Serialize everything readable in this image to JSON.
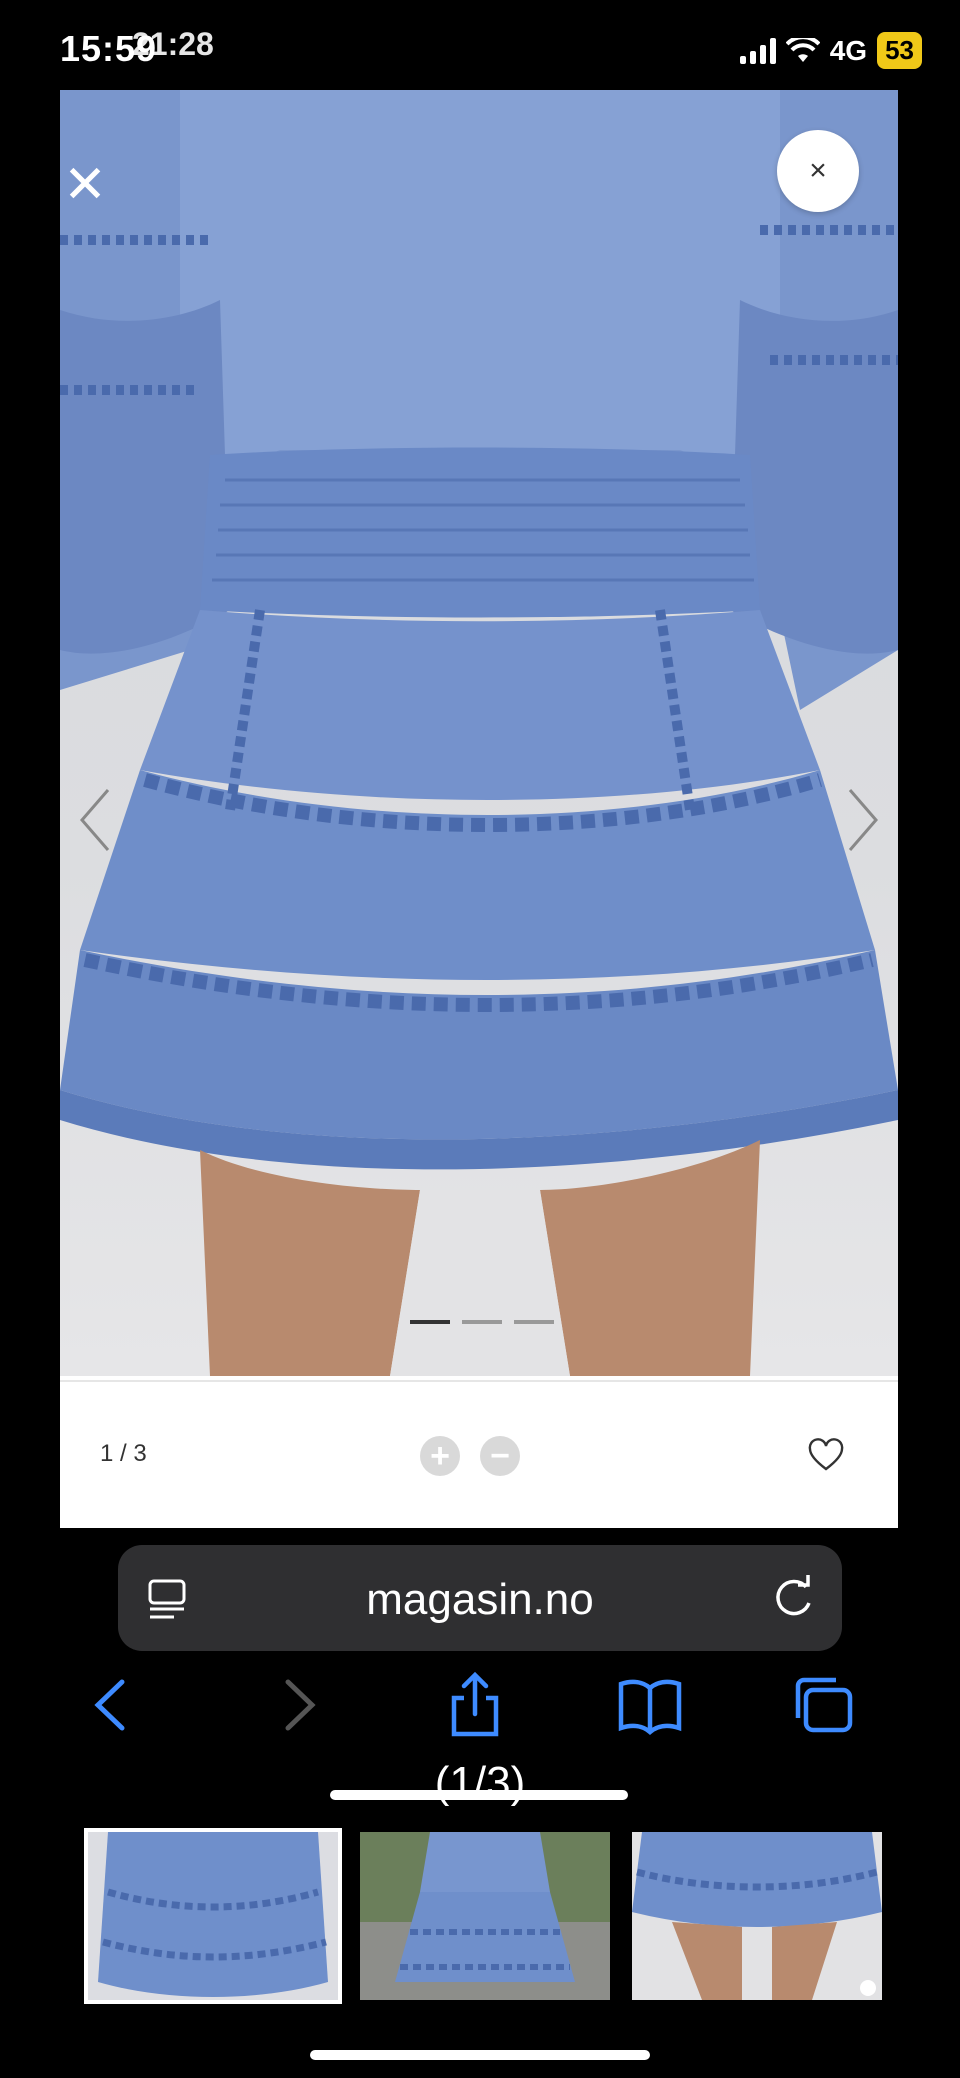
{
  "status_bar": {
    "time": "15:59",
    "time_overlay": "21:28",
    "network": "4G",
    "battery": "53"
  },
  "viewer": {
    "counter": "1 / 3",
    "zoom_in": "+",
    "zoom_out": "−",
    "close_glyph": "×",
    "carousel_total": 3,
    "carousel_active_index": 1
  },
  "browser": {
    "domain": "magasin.no",
    "page_indicator": "(1/3)"
  },
  "thumbnails": [
    {
      "name": "skirt-front-thumb",
      "selected": true
    },
    {
      "name": "model-back-thumb",
      "selected": false
    },
    {
      "name": "skirt-legs-thumb",
      "selected": false
    }
  ],
  "colors": {
    "skirt": "#6f8fcb",
    "skirt_shadow": "#5b7cbc",
    "lace": "#4a6aac",
    "skin": "#b88a6e",
    "browser_accent": "#3e8bff",
    "battery": "#f0c818"
  },
  "icons": {
    "close": "close-icon",
    "favorite": "heart-icon",
    "share": "share-icon",
    "bookmarks": "book-icon",
    "tabs": "tabs-icon",
    "reader": "reader-icon",
    "reload": "reload-icon"
  }
}
